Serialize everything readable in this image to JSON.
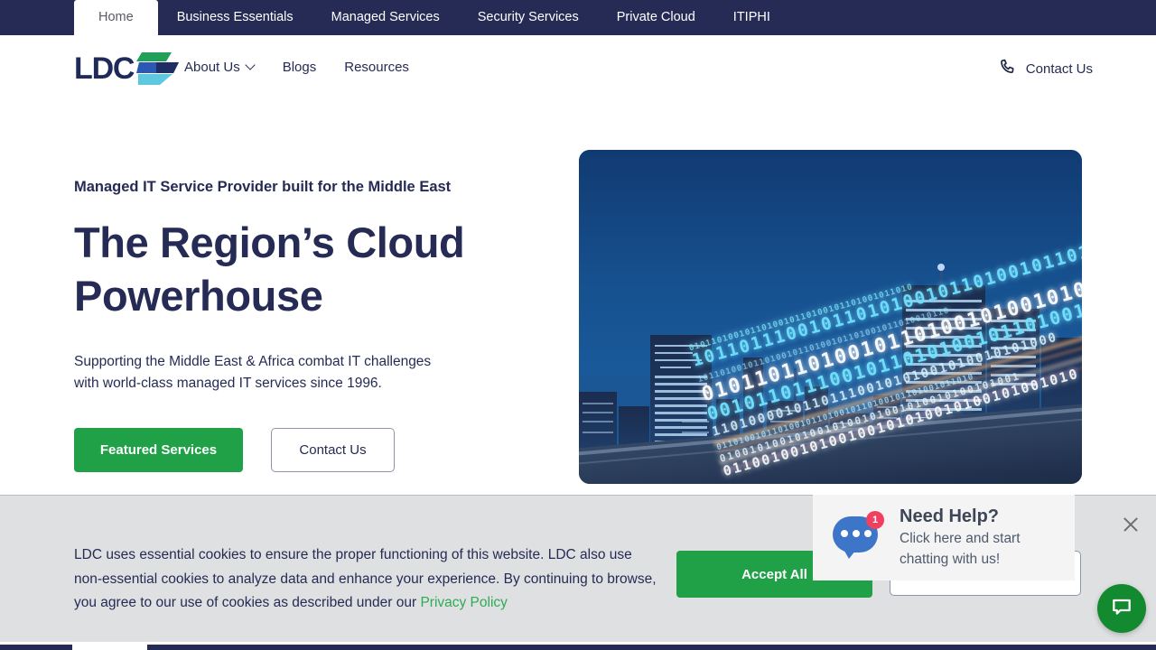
{
  "topnav": {
    "tabs": [
      {
        "label": "Home",
        "active": true
      },
      {
        "label": "Business Essentials",
        "active": false
      },
      {
        "label": "Managed Services",
        "active": false
      },
      {
        "label": "Security Services",
        "active": false
      },
      {
        "label": "Private Cloud",
        "active": false
      },
      {
        "label": "ITIPHI",
        "active": false
      }
    ]
  },
  "header": {
    "logo_text": "LDC",
    "logo_icon": "ldc-stacked-bands-logo",
    "nav": [
      {
        "label": "About Us",
        "has_dropdown": true
      },
      {
        "label": "Blogs",
        "has_dropdown": false
      },
      {
        "label": "Resources",
        "has_dropdown": false
      }
    ],
    "contact": {
      "label": "Contact Us",
      "icon": "phone-icon"
    }
  },
  "hero": {
    "eyebrow": "Managed IT Service Provider built for the Middle East",
    "heading_line1": "The Region’s Cloud",
    "heading_line2": "Powerhouse",
    "lede_line1": "Supporting the Middle East & Africa combat IT challenges",
    "lede_line2": "with world-class managed IT services since 1996.",
    "primary_cta": "Featured Services",
    "secondary_cta": "Contact Us",
    "image_alt": "night-city-binary-light-trails"
  },
  "cookie": {
    "text_before_link": "LDC uses essential cookies to ensure the proper functioning of this website. LDC also use non-essential cookies to analyze data and enhance your experience. By continuing to browse, you agree to our use of cookies as described under our ",
    "link_label": "Privacy Policy",
    "accept_label": "Accept All",
    "reject_label": ""
  },
  "chat": {
    "badge_count": "1",
    "heading": "Need Help?",
    "subtext_line1": "Click here and start",
    "subtext_line2": "chatting with us!",
    "close_icon": "close-icon",
    "fab_icon": "chat-bubble-icon"
  },
  "colors": {
    "navy": "#252b54",
    "green": "#20a148",
    "fab_green": "#138a2f",
    "link_green": "#2faa55",
    "cookie_bg": "#dfe0e1",
    "chat_blue": "#3d76c8",
    "badge_red": "#f04060",
    "logo_green": "#22a05a",
    "logo_blue": "#2b57b5",
    "logo_cyan": "#5ec8e0"
  }
}
